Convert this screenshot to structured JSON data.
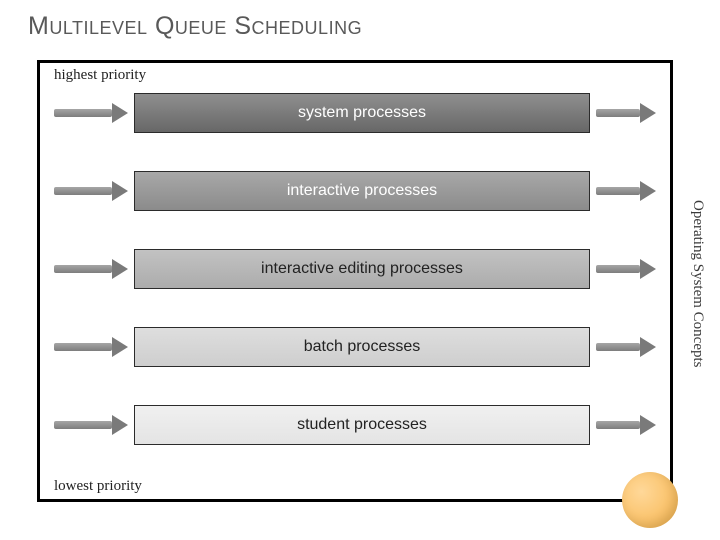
{
  "title": "Multilevel Queue Scheduling",
  "priority_high_label": "highest priority",
  "priority_low_label": "lowest priority",
  "side_label": "Operating System Concepts",
  "queues": [
    {
      "label": "system processes"
    },
    {
      "label": "interactive processes"
    },
    {
      "label": "interactive editing processes"
    },
    {
      "label": "batch processes"
    },
    {
      "label": "student processes"
    }
  ]
}
